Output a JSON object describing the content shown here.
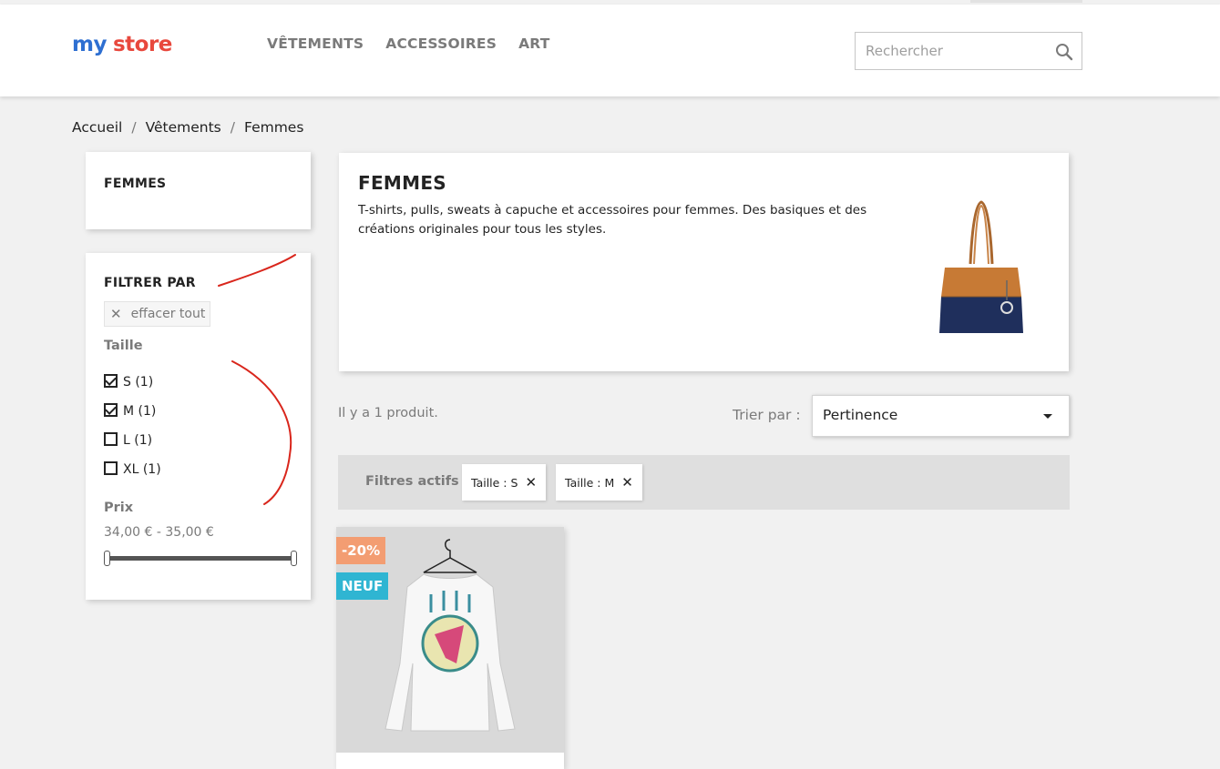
{
  "header": {
    "logo_text_1": "my",
    "logo_text_2": "store",
    "nav": [
      "VÊTEMENTS",
      "ACCESSOIRES",
      "ART"
    ],
    "search_placeholder": "Rechercher",
    "search_icon": "search-icon"
  },
  "breadcrumb": [
    "Accueil",
    "Vêtements",
    "Femmes"
  ],
  "category_block": {
    "title": "FEMMES"
  },
  "filters": {
    "title": "FILTRER PAR",
    "clear_all": "effacer tout",
    "size_title": "Taille",
    "sizes": [
      {
        "label": "S (1)",
        "checked": true
      },
      {
        "label": "M (1)",
        "checked": true
      },
      {
        "label": "L (1)",
        "checked": false
      },
      {
        "label": "XL (1)",
        "checked": false
      }
    ],
    "price_title": "Prix",
    "price_range": "34,00 € - 35,00 €"
  },
  "category_header": {
    "title": "FEMMES",
    "description": "T-shirts, pulls, sweats à capuche et accessoires pour femmes. Des basiques et des créations originales pour tous les styles."
  },
  "listing": {
    "count": "Il y a 1 produit.",
    "sort_label": "Trier par :",
    "sort_value": "Pertinence",
    "active_filters_label": "Filtres actifs",
    "active_filters": [
      "Taille : S",
      "Taille : M"
    ]
  },
  "product": {
    "discount_badge": "-20%",
    "new_badge": "NEUF"
  },
  "colors": {
    "discount": "#f39d72",
    "new": "#2fb5d2",
    "annotation": "#d9261c"
  }
}
